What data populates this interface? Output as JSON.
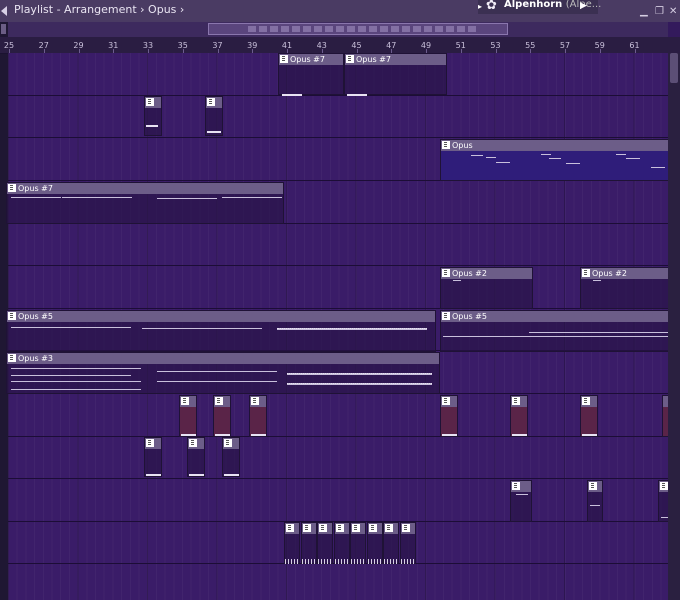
{
  "titlebar": {
    "title": "Playlist - Arrangement › Opus ›",
    "instrument_name": "Alpenhorn",
    "instrument_suffix": "(Alpe...",
    "icons": [
      "playlist-arrow-icon",
      "gear-icon",
      "play-arrow-icon",
      "minimize-icon",
      "restore-icon",
      "close-icon"
    ]
  },
  "ruler": {
    "bars": [
      "25",
      "27",
      "29",
      "31",
      "33",
      "35",
      "37",
      "39",
      "41",
      "43",
      "45",
      "47",
      "49",
      "51",
      "53",
      "55",
      "57",
      "59",
      "61"
    ]
  },
  "clips": [
    {
      "label": "Opus #7"
    },
    {
      "label": "Opus #7"
    },
    {
      "label": "Opus"
    },
    {
      "label": "Opus #7"
    },
    {
      "label": "Opus #2"
    },
    {
      "label": "Opus #2"
    },
    {
      "label": "Opus #5"
    },
    {
      "label": "Opus #5"
    },
    {
      "label": "Opus #3"
    }
  ],
  "colors": {
    "background": "#3a1c68",
    "clip_header": "#6c5d88",
    "clip_blue": "#2f1d7a",
    "note": "#e8e2f3"
  }
}
